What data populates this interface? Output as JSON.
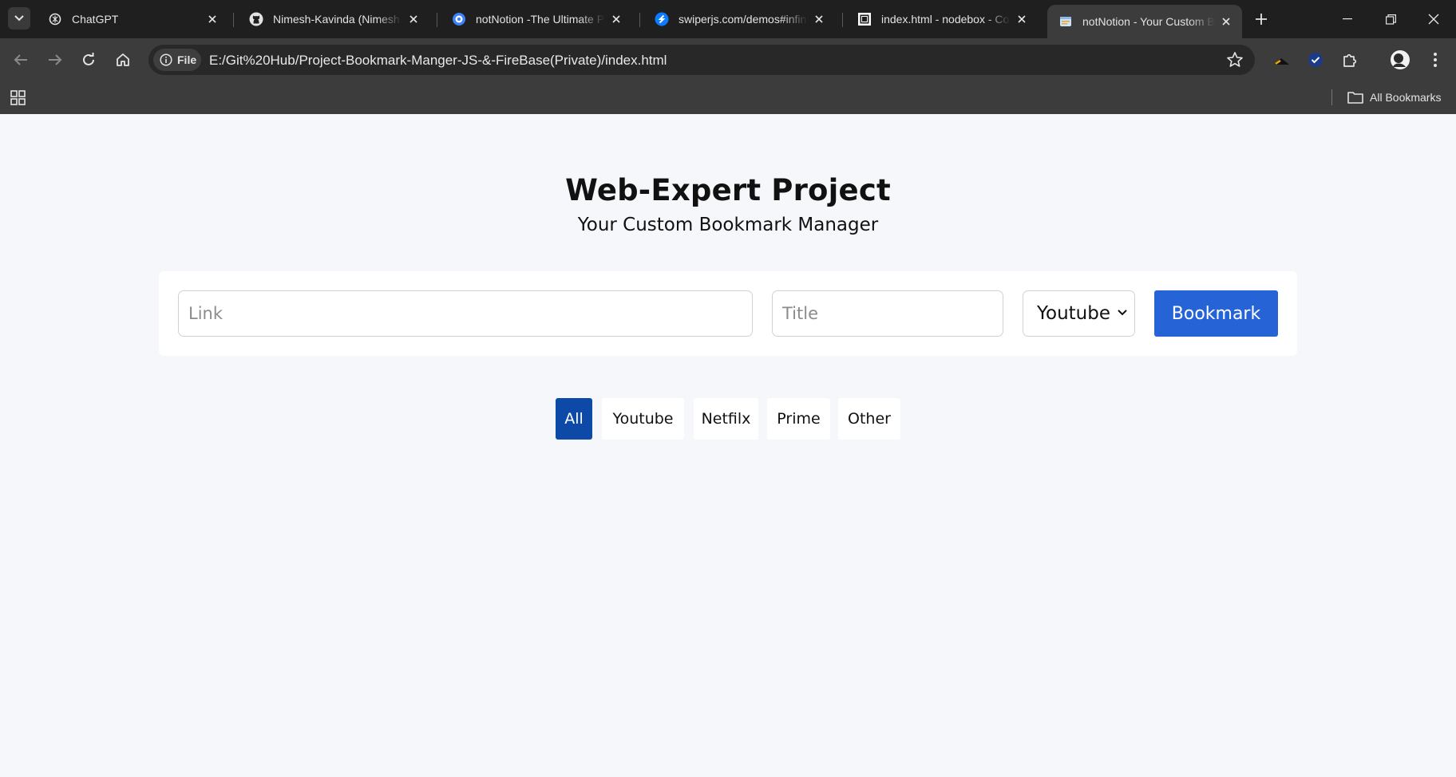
{
  "browser": {
    "tabs": [
      {
        "title": "ChatGPT",
        "icon": "chatgpt-icon"
      },
      {
        "title": "Nimesh-Kavinda (Nimesh Kavinda)",
        "icon": "github-icon"
      },
      {
        "title": "notNotion -The Ultimate Productivity",
        "icon": "notnotion-icon"
      },
      {
        "title": "swiperjs.com/demos#infinite-loop",
        "icon": "swiper-icon"
      },
      {
        "title": "index.html - nodebox - CodeSandbox",
        "icon": "codesandbox-icon"
      },
      {
        "title": "notNotion - Your Custom Bookmark",
        "icon": "page-icon"
      }
    ],
    "active_tab": 5,
    "site_info_label": "File",
    "url": "E:/Git%20Hub/Project-Bookmark-Manger-JS-&-FireBase(Private)/index.html",
    "all_bookmarks_label": "All Bookmarks"
  },
  "page": {
    "title": "Web-Expert Project",
    "subtitle": "Your Custom Bookmark Manager",
    "form": {
      "link_placeholder": "Link",
      "link_value": "",
      "title_placeholder": "Title",
      "title_value": "",
      "category_selected": "Youtube",
      "submit_label": "Bookmark"
    },
    "filters": [
      {
        "label": "All",
        "active": true
      },
      {
        "label": "Youtube",
        "active": false
      },
      {
        "label": "Netfilx",
        "active": false
      },
      {
        "label": "Prime",
        "active": false
      },
      {
        "label": "Other",
        "active": false
      }
    ]
  },
  "colors": {
    "accent_blue": "#2563d6",
    "active_filter": "#0d4aa8",
    "page_bg": "#f5f7fb",
    "chrome_dark": "#1f1f1f",
    "chrome_toolbar": "#3c3c3c"
  }
}
